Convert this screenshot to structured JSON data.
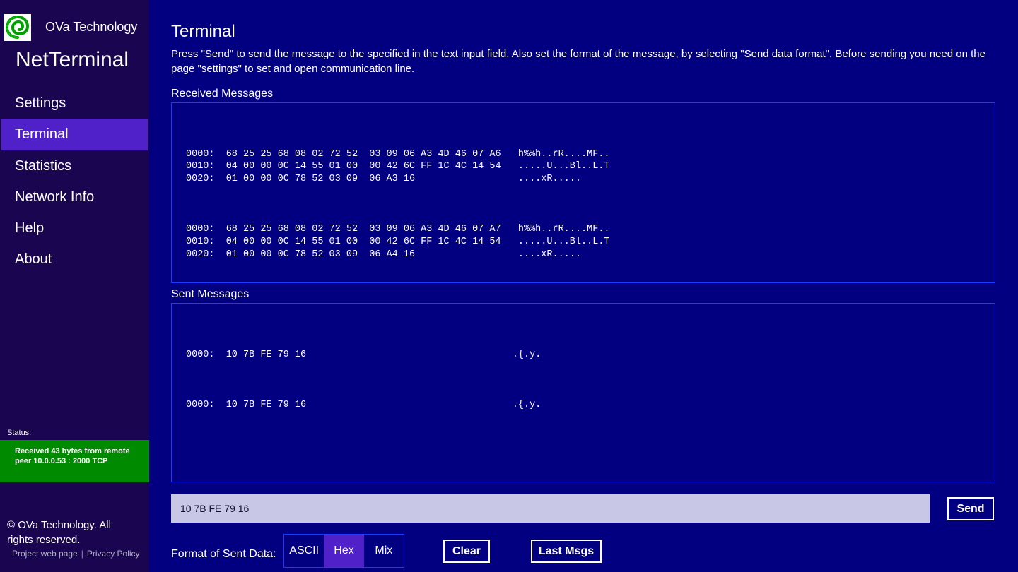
{
  "app": {
    "company": "OVa Technology",
    "title": "NetTerminal",
    "logo_icon": "spiral-logo-icon"
  },
  "sidebar": {
    "items": [
      {
        "label": "Settings",
        "active": false
      },
      {
        "label": "Terminal",
        "active": true
      },
      {
        "label": "Statistics",
        "active": false
      },
      {
        "label": "Network Info",
        "active": false
      },
      {
        "label": "Help",
        "active": false
      },
      {
        "label": "About",
        "active": false
      }
    ],
    "status_label": "Status:",
    "status_line1": "Received 43 bytes from remote",
    "status_line2": "peer 10.0.0.53 : 2000 TCP",
    "status_color": "#008a00",
    "copyright_line1": "© OVa Technology. All",
    "copyright_line2": "rights reserved.",
    "link_project": "Project web page",
    "link_separator": "|",
    "link_privacy": "Privacy Policy"
  },
  "main": {
    "title": "Terminal",
    "description": "Press \"Send\" to send the message to the specified in the text input field. Also set the format of the message, by selecting \"Send data format\". Before sending you need on the page \"settings\" to set and open communication line.",
    "received_label": "Received Messages",
    "received_blocks": [
      "0000:  68 25 25 68 08 02 72 52  03 09 06 A3 4D 46 07 A6   h%%h..rR....MF..\n0010:  04 00 00 0C 14 55 01 00  00 42 6C FF 1C 4C 14 54   .....U...Bl..L.T\n0020:  01 00 00 0C 78 52 03 09  06 A3 16                  ....xR.....",
      "0000:  68 25 25 68 08 02 72 52  03 09 06 A3 4D 46 07 A7   h%%h..rR....MF..\n0010:  04 00 00 0C 14 55 01 00  00 42 6C FF 1C 4C 14 54   .....U...Bl..L.T\n0020:  01 00 00 0C 78 52 03 09  06 A4 16                  ....xR....."
    ],
    "sent_label": "Sent Messages",
    "sent_blocks": [
      "0000:  10 7B FE 79 16                                    .{.y.",
      "0000:  10 7B FE 79 16                                    .{.y."
    ],
    "input_value": "10 7B FE 79 16",
    "send_label": "Send",
    "format_label": "Format of Sent Data:",
    "format_options": [
      "ASCII",
      "Hex",
      "Mix"
    ],
    "format_selected": "Hex",
    "clear_label": "Clear",
    "last_msgs_label": "Last Msgs"
  },
  "colors": {
    "background": "#020080",
    "sidebar": "#1a0550",
    "accent": "#5020c8",
    "panel_border": "#1a3cff",
    "input_bg": "#c8c8e6"
  }
}
